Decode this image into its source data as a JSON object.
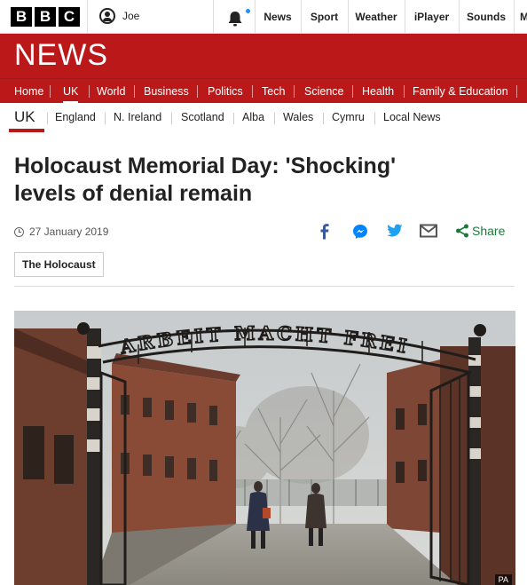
{
  "topbar": {
    "logo_letters": [
      "B",
      "B",
      "C"
    ],
    "account_name": "Joe",
    "nav": [
      "News",
      "Sport",
      "Weather",
      "iPlayer",
      "Sounds",
      "M"
    ]
  },
  "masthead": {
    "title": "NEWS"
  },
  "section_nav": [
    "Home",
    "UK",
    "World",
    "Business",
    "Politics",
    "Tech",
    "Science",
    "Health",
    "Family & Education"
  ],
  "sub_nav": {
    "current": "UK",
    "items": [
      "England",
      "N. Ireland",
      "Scotland",
      "Alba",
      "Wales",
      "Cymru",
      "Local News"
    ]
  },
  "article": {
    "headline_line1": "Holocaust Memorial Day: 'Shocking'",
    "headline_line2": "levels of denial remain",
    "date": "27 January 2019",
    "share_label": "Share",
    "tag": "The Holocaust",
    "photo_sign": "ARBEIT MACHT FREI",
    "photo_credit": "PA"
  },
  "colors": {
    "brand_red": "#bb1919",
    "share_green": "#1c7a3b",
    "facebook": "#3b5998",
    "messenger": "#0084ff",
    "twitter": "#1da1f2"
  },
  "icons": [
    "user-icon",
    "bell-icon",
    "clock-icon",
    "facebook-icon",
    "messenger-icon",
    "twitter-icon",
    "email-icon",
    "share-icon"
  ]
}
